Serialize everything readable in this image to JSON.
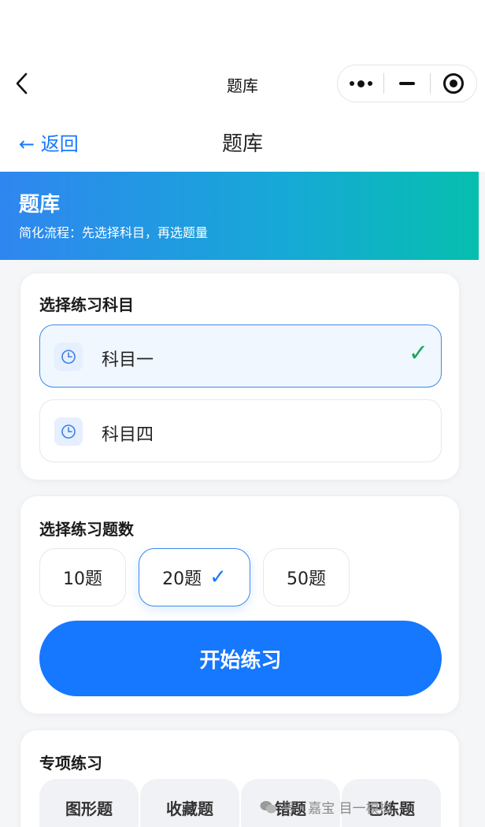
{
  "wechat_bar": {
    "title": "题库"
  },
  "page_nav": {
    "back_label": "← 返回",
    "title": "题库"
  },
  "hero": {
    "title": "题库",
    "subtitle": "简化流程：先选择科目，再选题量"
  },
  "subject_card": {
    "title": "选择练习科目",
    "items": [
      {
        "label": "科目一",
        "selected": true
      },
      {
        "label": "科目四",
        "selected": false
      }
    ]
  },
  "count_card": {
    "title": "选择练习题数",
    "options": [
      {
        "label": "10题",
        "selected": false
      },
      {
        "label": "20题",
        "selected": true
      },
      {
        "label": "50题",
        "selected": false
      }
    ],
    "check_mark": "✓",
    "start_label": "开始练习"
  },
  "special_card": {
    "title": "专项练习",
    "items": [
      "图形题",
      "收藏题",
      "错题",
      "已练题"
    ]
  },
  "subject_check_mark": "✓",
  "watermark": {
    "text": "号 · 嘉宝 目一模拟"
  },
  "colors": {
    "primary": "#1677ff",
    "check_green": "#1aa760",
    "hero_start": "#2f86f0",
    "hero_end": "#06bfae"
  }
}
